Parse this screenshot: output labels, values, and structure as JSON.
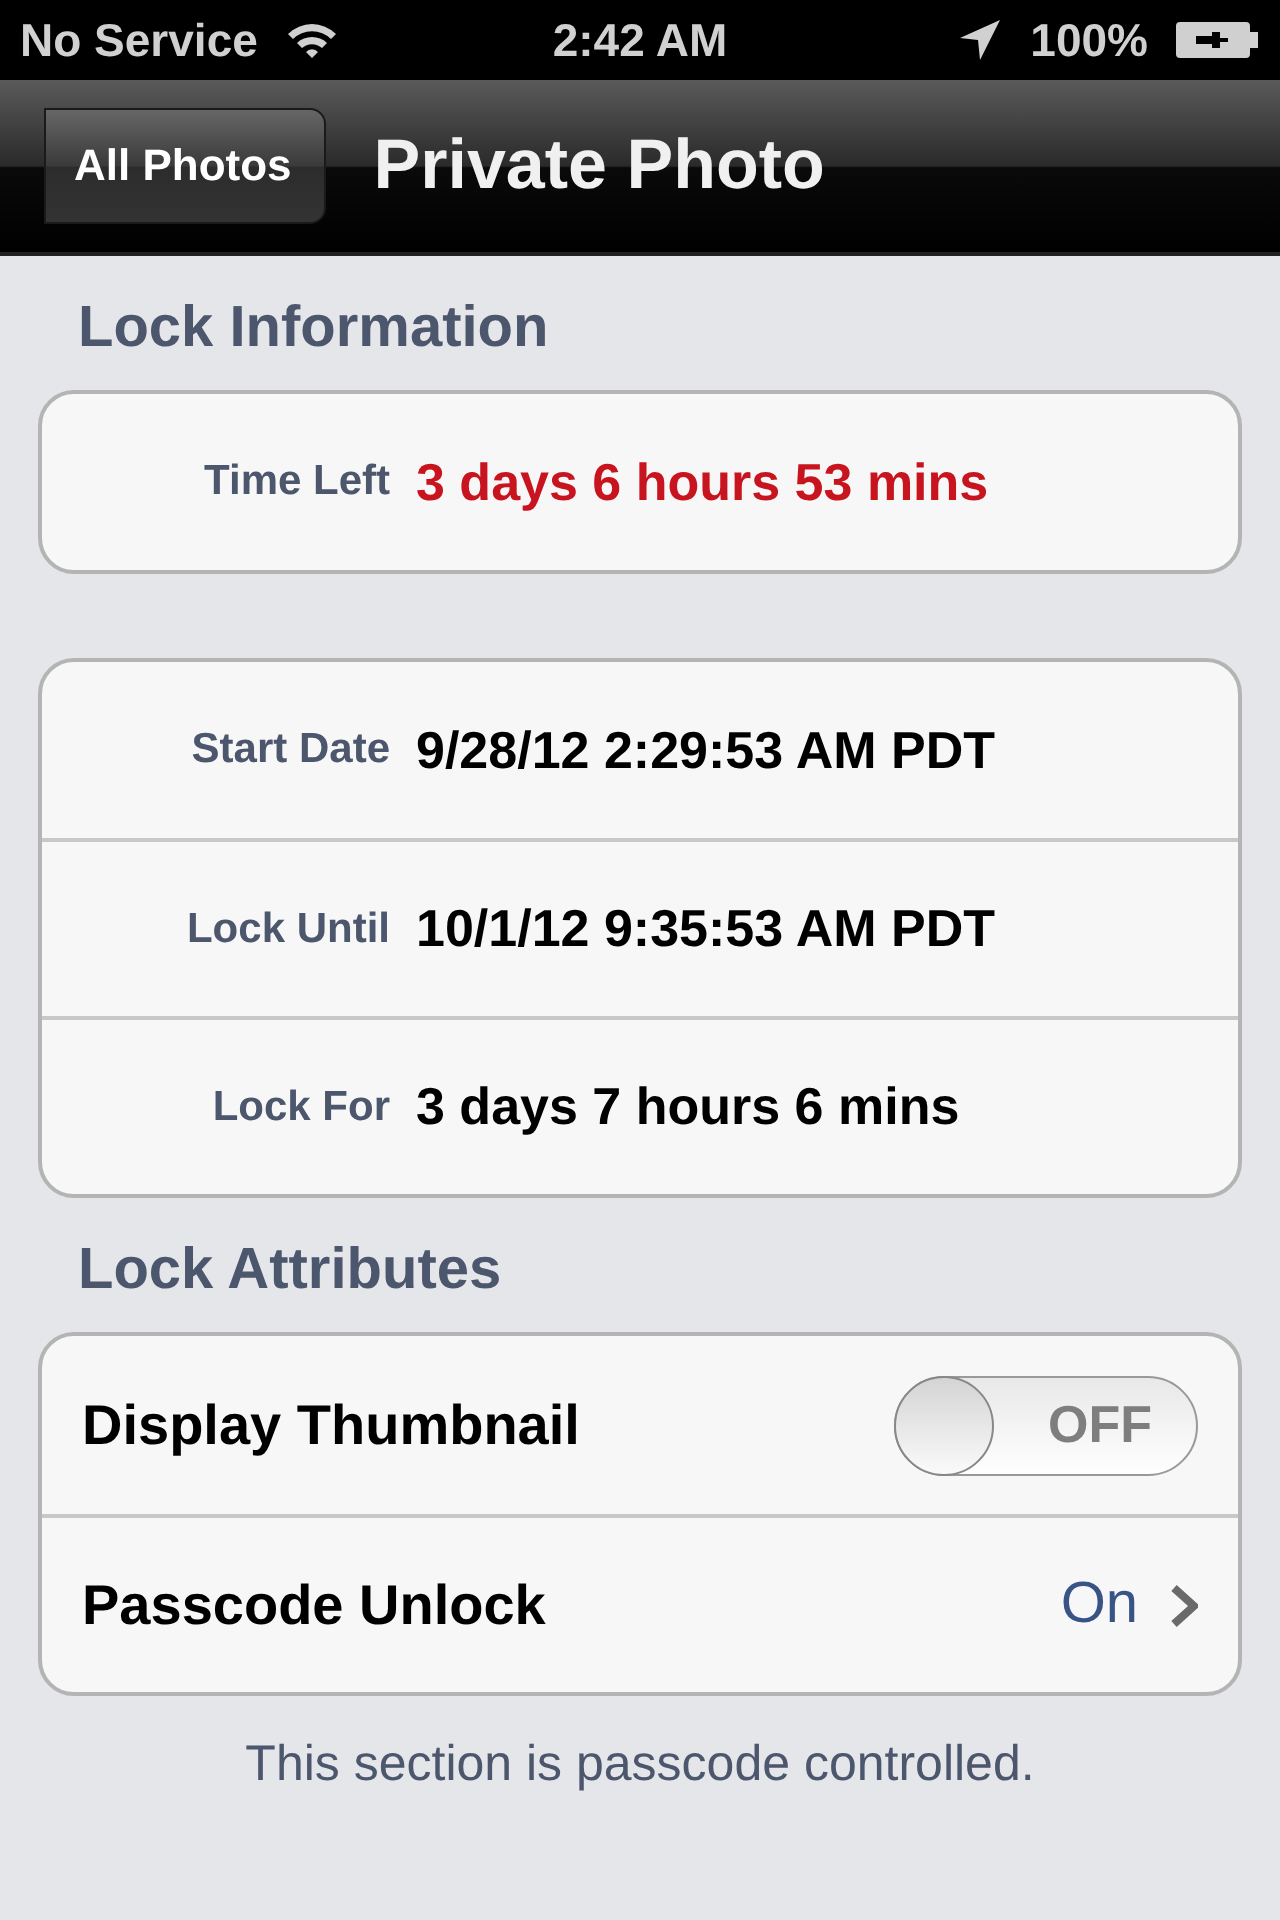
{
  "status_bar": {
    "carrier": "No Service",
    "time": "2:42 AM",
    "battery": "100%"
  },
  "nav_bar": {
    "back": "All Photos",
    "title": "Private Photo"
  },
  "lock_information": {
    "header": "Lock Information",
    "groups": [
      [
        {
          "label": "Time Left",
          "value": "3 days 6 hours 53 mins",
          "alert": true
        }
      ],
      [
        {
          "label": "Start Date",
          "value": "9/28/12 2:29:53 AM PDT",
          "alert": false
        },
        {
          "label": "Lock Until",
          "value": "10/1/12 9:35:53 AM PDT",
          "alert": false
        },
        {
          "label": "Lock For",
          "value": "3 days 7 hours 6 mins",
          "alert": false
        }
      ]
    ]
  },
  "lock_attributes": {
    "header": "Lock Attributes",
    "rows": [
      {
        "kind": "switch",
        "label": "Display Thumbnail",
        "on": false,
        "switch_text": "OFF"
      },
      {
        "kind": "disclosure",
        "label": "Passcode Unlock",
        "value": "On"
      }
    ],
    "footer": "This section is passcode controlled."
  }
}
